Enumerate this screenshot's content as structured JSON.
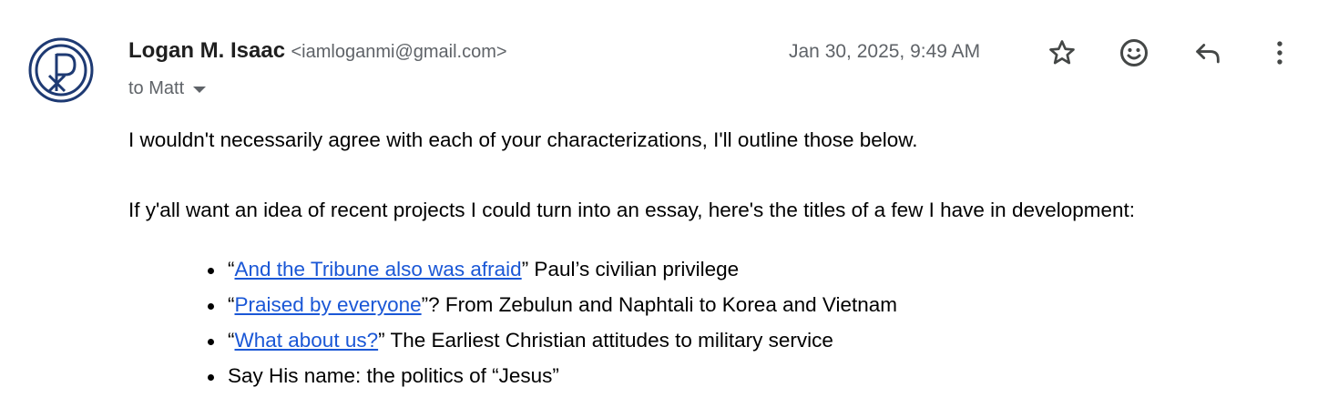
{
  "sender": {
    "name": "Logan M. Isaac",
    "email": "<iamloganmi@gmail.com>"
  },
  "recipient": "to Matt",
  "timestamp": "Jan 30, 2025, 9:49 AM",
  "icons": {
    "avatar": "chi-rho-logo",
    "star": "star-outline-icon",
    "emoji": "emoji-smile-icon",
    "reply": "reply-arrow-icon",
    "more": "more-vert-icon"
  },
  "colors": {
    "brand_navy": "#1e3a73",
    "link": "#1a57d6",
    "muted": "#5f6368"
  },
  "body": {
    "paragraph1": "I wouldn't necessarily agree with each of your characterizations, I'll outline those below.",
    "paragraph2": "If y'all want an idea of recent projects I could turn into an essay, here's the titles of a few I have in development:",
    "items": [
      {
        "prefix": "“",
        "link": "And the Tribune also was afraid",
        "suffix": "” Paul’s civilian privilege"
      },
      {
        "prefix": "“",
        "link": "Praised by everyone",
        "suffix": "”? From Zebulun and Naphtali to Korea and Vietnam"
      },
      {
        "prefix": "“",
        "link": "What about us?",
        "suffix": "” The Earliest Christian attitudes to military service"
      },
      {
        "prefix": "Say His name: the politics of “Jesus”",
        "link": "",
        "suffix": ""
      }
    ]
  }
}
